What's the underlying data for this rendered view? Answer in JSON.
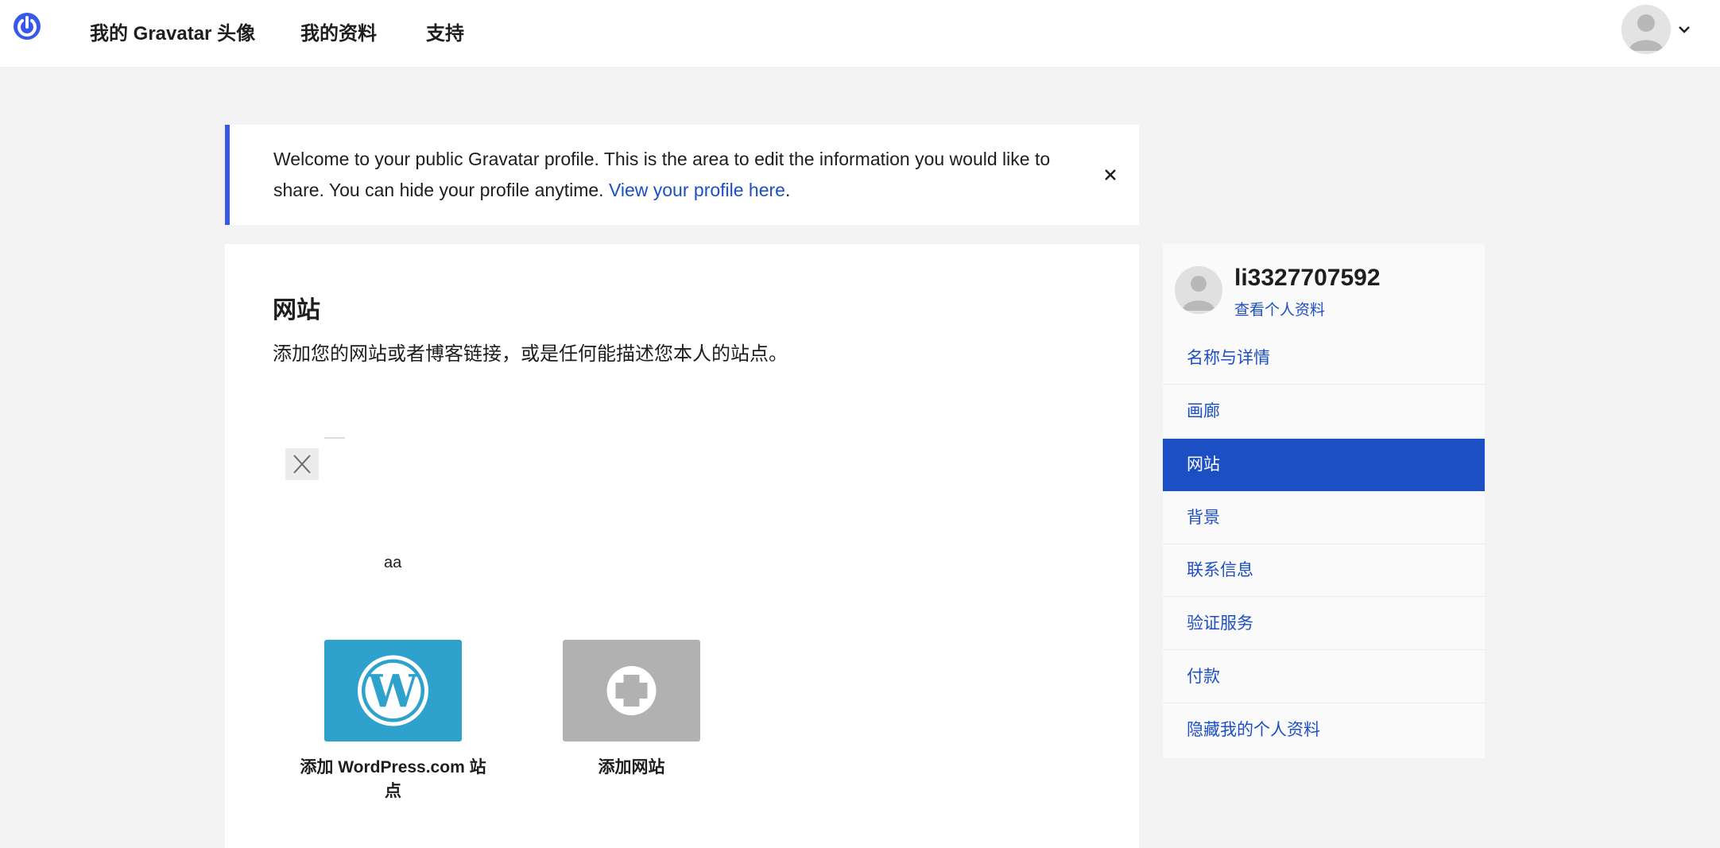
{
  "header": {
    "logo_icon": "gravatar-power-icon",
    "nav": [
      {
        "label": "我的 Gravatar 头像"
      },
      {
        "label": "我的资料"
      },
      {
        "label": "支持"
      }
    ],
    "user_menu": {
      "avatar_icon": "default-avatar-icon",
      "chevron_icon": "chevron-down-icon"
    }
  },
  "notice": {
    "text": "Welcome to your public Gravatar profile. This is the area to edit the information you would like to share. You can hide your profile anytime.",
    "link_text": "View your profile here",
    "trailing": ".",
    "close_icon": "close-icon"
  },
  "main": {
    "title": "网站",
    "description": "添加您的网站或者博客链接，或是任何能描述您本人的站点。",
    "sites": [
      {
        "name": "aa"
      }
    ],
    "add_wordpress_label": "添加 WordPress.com 站点",
    "add_site_label": "添加网站",
    "wordpress_icon": "wordpress-logo-icon",
    "plus_icon": "plus-circle-icon"
  },
  "sidebar": {
    "username": "li3327707592",
    "view_profile": "查看个人资料",
    "items": [
      {
        "label": "名称与详情"
      },
      {
        "label": "画廊"
      },
      {
        "label": "网站",
        "active": true
      },
      {
        "label": "背景"
      },
      {
        "label": "联系信息"
      },
      {
        "label": "验证服务"
      },
      {
        "label": "付款"
      },
      {
        "label": "隐藏我的个人资料"
      }
    ]
  },
  "colors": {
    "accent": "#1d4fc4",
    "notice_border": "#3858e9",
    "wordpress_tile": "#2ea2cc",
    "add_tile": "#b1b1b1",
    "page_bg": "#f3f3f3"
  }
}
